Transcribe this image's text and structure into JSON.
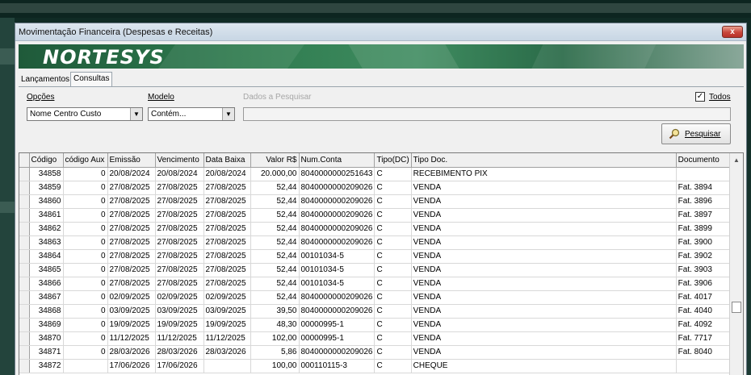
{
  "window": {
    "title": "Movimentação Financeira (Despesas e Receitas)",
    "close_label": "x",
    "logo": "NORTESYS"
  },
  "tabs": [
    {
      "label": "Lançamentos",
      "active": false
    },
    {
      "label": "Consultas",
      "active": true
    }
  ],
  "filters": {
    "opcoes_label": "Opções",
    "opcoes_value": "Nome Centro Custo",
    "modelo_label": "Modelo",
    "modelo_value": "Contém...",
    "dados_label": "Dados a Pesquisar",
    "dados_value": "",
    "todos_label": "Todos",
    "todos_checked": "✓",
    "search_button": "Pesquisar"
  },
  "table": {
    "columns": [
      "Código",
      "código Aux",
      "Emissão",
      "Vencimento",
      "Data Baixa",
      "Valor R$",
      "Num.Conta",
      "Tipo(DC)",
      "Tipo Doc.",
      "Documento"
    ],
    "rows": [
      [
        "34858",
        "0",
        "20/08/2024",
        "20/08/2024",
        "20/08/2024",
        "20.000,00",
        "8040000000251643",
        "C",
        "RECEBIMENTO PIX",
        ""
      ],
      [
        "34859",
        "0",
        "27/08/2025",
        "27/08/2025",
        "27/08/2025",
        "52,44",
        "8040000000209026",
        "C",
        "VENDA",
        "Fat. 3894"
      ],
      [
        "34860",
        "0",
        "27/08/2025",
        "27/08/2025",
        "27/08/2025",
        "52,44",
        "8040000000209026",
        "C",
        "VENDA",
        "Fat. 3896"
      ],
      [
        "34861",
        "0",
        "27/08/2025",
        "27/08/2025",
        "27/08/2025",
        "52,44",
        "8040000000209026",
        "C",
        "VENDA",
        "Fat. 3897"
      ],
      [
        "34862",
        "0",
        "27/08/2025",
        "27/08/2025",
        "27/08/2025",
        "52,44",
        "8040000000209026",
        "C",
        "VENDA",
        "Fat. 3899"
      ],
      [
        "34863",
        "0",
        "27/08/2025",
        "27/08/2025",
        "27/08/2025",
        "52,44",
        "8040000000209026",
        "C",
        "VENDA",
        "Fat. 3900"
      ],
      [
        "34864",
        "0",
        "27/08/2025",
        "27/08/2025",
        "27/08/2025",
        "52,44",
        "00101034-5",
        "C",
        "VENDA",
        "Fat. 3902"
      ],
      [
        "34865",
        "0",
        "27/08/2025",
        "27/08/2025",
        "27/08/2025",
        "52,44",
        "00101034-5",
        "C",
        "VENDA",
        "Fat. 3903"
      ],
      [
        "34866",
        "0",
        "27/08/2025",
        "27/08/2025",
        "27/08/2025",
        "52,44",
        "00101034-5",
        "C",
        "VENDA",
        "Fat. 3906"
      ],
      [
        "34867",
        "0",
        "02/09/2025",
        "02/09/2025",
        "02/09/2025",
        "52,44",
        "8040000000209026",
        "C",
        "VENDA",
        "Fat. 4017"
      ],
      [
        "34868",
        "0",
        "03/09/2025",
        "03/09/2025",
        "03/09/2025",
        "39,50",
        "8040000000209026",
        "C",
        "VENDA",
        "Fat. 4040"
      ],
      [
        "34869",
        "0",
        "19/09/2025",
        "19/09/2025",
        "19/09/2025",
        "48,30",
        "00000995-1",
        "C",
        "VENDA",
        "Fat. 4092"
      ],
      [
        "34870",
        "0",
        "11/12/2025",
        "11/12/2025",
        "11/12/2025",
        "102,00",
        "00000995-1",
        "C",
        "VENDA",
        "Fat. 7717"
      ],
      [
        "34871",
        "0",
        "28/03/2026",
        "28/03/2026",
        "28/03/2026",
        "5,86",
        "8040000000209026",
        "C",
        "VENDA",
        "Fat. 8040"
      ],
      [
        "34872",
        "",
        "17/06/2026",
        "17/06/2026",
        "",
        "100,00",
        "000110115-3",
        "C",
        "CHEQUE",
        ""
      ]
    ]
  }
}
